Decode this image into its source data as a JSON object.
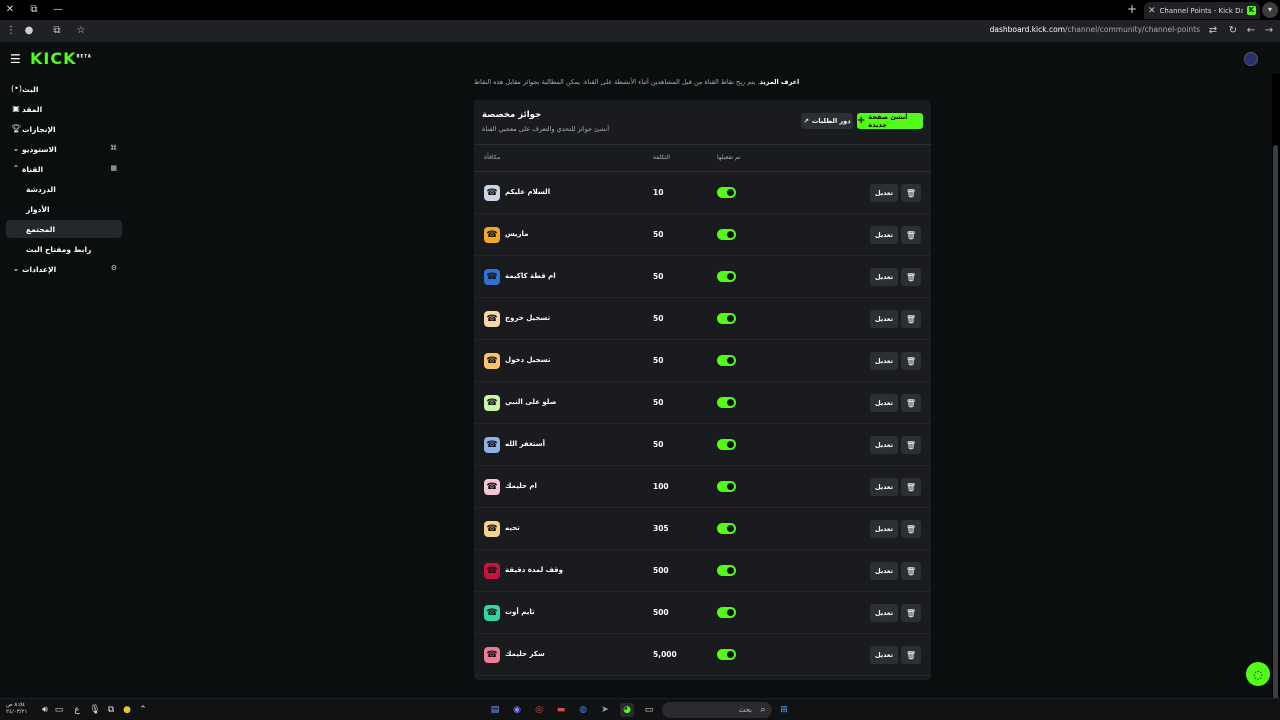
{
  "browser": {
    "tab_title": "Channel Points - Kick Dashboard",
    "url_host": "dashboard.kick.com",
    "url_path": "/channel/community/channel-points"
  },
  "header": {
    "logo": "KICK",
    "logo_badge": "BETA"
  },
  "sidebar": {
    "items": [
      {
        "label": "البث",
        "icon": "broadcast-icon"
      },
      {
        "label": "المقد",
        "icon": "content-icon"
      },
      {
        "label": "الإنجازات",
        "icon": "trophy-icon"
      },
      {
        "label": "الاستوديو",
        "icon": "studio-icon"
      },
      {
        "label": "القناة",
        "icon": "channel-icon"
      },
      {
        "label": "الإعدادات",
        "icon": "settings-icon"
      }
    ],
    "sub_items": [
      {
        "label": "الدردشة"
      },
      {
        "label": "الأدوار"
      },
      {
        "label": "المجتمع"
      },
      {
        "label": "رابط ومفتاح البث"
      }
    ]
  },
  "intro": {
    "bold": "اعرف المزيد",
    "text": ". يتم ربح نقاط القناة من قبل المشاهدين أثناء الأنشطة على القناة. يمكن المطالبة بجوائز مقابل هذه النقاط"
  },
  "rewards_panel": {
    "title": "جوائز مخصصة",
    "subtitle": "أنشئ جوائز للتحدي والتعرف على معجبي القناة",
    "create_button": "أنشئ صفحة جديدة",
    "requests_button": "دور الطلبات",
    "columns": {
      "reward": "مكافأة",
      "cost": "التكلفة",
      "enabled": "تم تفعيلها"
    },
    "edit_label": "تعديل",
    "rows": [
      {
        "name": "السلام عليكم",
        "cost": "10",
        "color": "#c9d4e6"
      },
      {
        "name": "ماريس",
        "cost": "50",
        "color": "#f5a623"
      },
      {
        "name": "ام قطة كاكيمة",
        "cost": "50",
        "color": "#2f6fd6"
      },
      {
        "name": "تسجيل خروج",
        "cost": "50",
        "color": "#f7d9a8"
      },
      {
        "name": "تسجيل دخول",
        "cost": "50",
        "color": "#f7c46b"
      },
      {
        "name": "صلو على النبي",
        "cost": "50",
        "color": "#c9f5a8"
      },
      {
        "name": "أستغفر الله",
        "cost": "50",
        "color": "#8fb2e6"
      },
      {
        "name": "ام حليمك",
        "cost": "100",
        "color": "#f5c6d6"
      },
      {
        "name": "تحيه",
        "cost": "305",
        "color": "#f7d38a"
      },
      {
        "name": "وقف لمدة دقيقة",
        "cost": "500",
        "color": "#c8143c"
      },
      {
        "name": "تايم أوت",
        "cost": "500",
        "color": "#2ed6a8"
      },
      {
        "name": "سكر حليمك",
        "cost": "5,000",
        "color": "#f07a94"
      }
    ]
  },
  "taskbar": {
    "search_placeholder": "بحث",
    "clock_time": "٨:٥٤ ص",
    "clock_date": "٢٤/٠٣/٢١"
  }
}
